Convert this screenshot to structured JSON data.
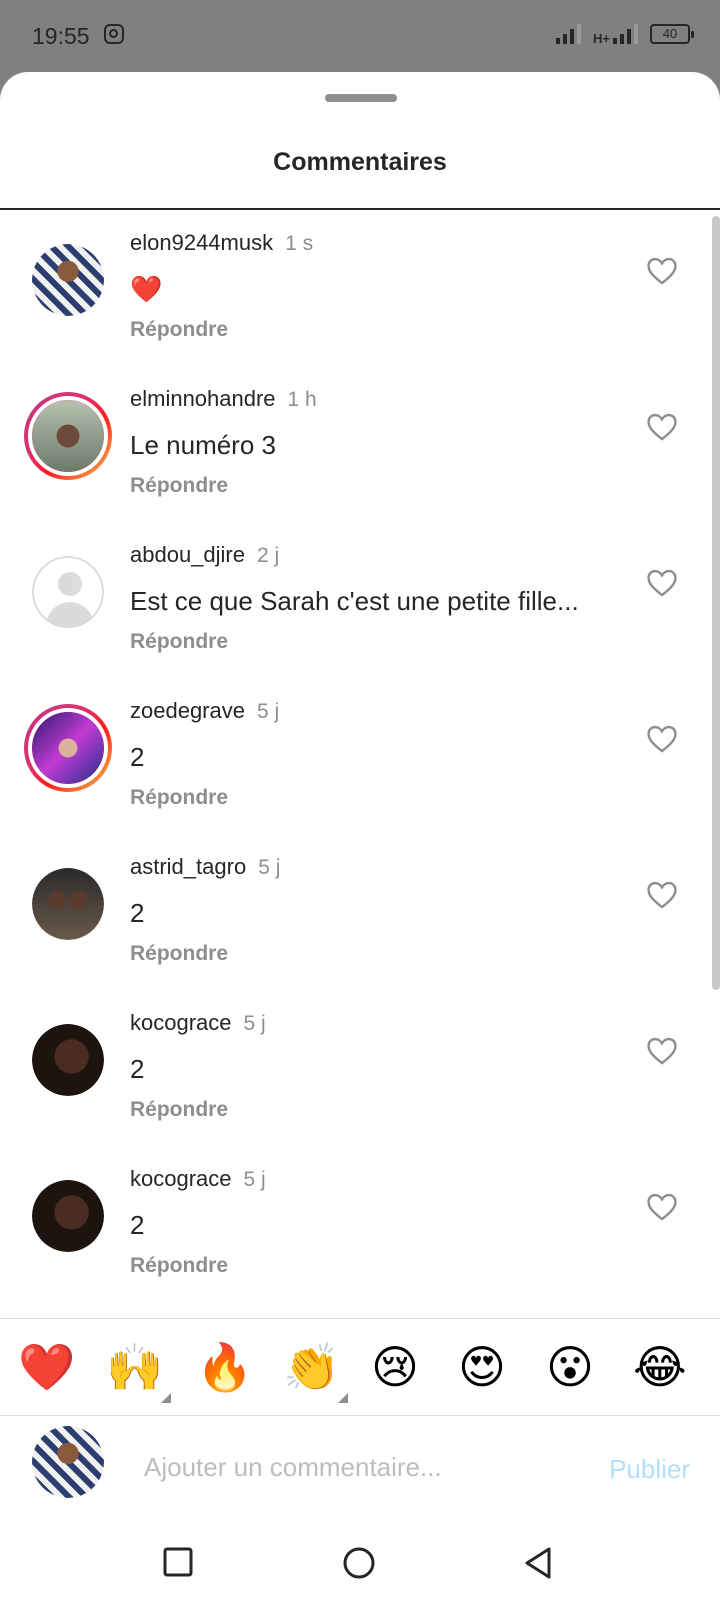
{
  "status_bar": {
    "time": "19:55",
    "network": "H+",
    "battery": "40"
  },
  "sheet": {
    "title": "Commentaires"
  },
  "comments": [
    {
      "username": "elon9244musk",
      "time": "1 s",
      "text": "❤️",
      "reply": "Répondre"
    },
    {
      "username": "elminnohandre",
      "time": "1 h",
      "text": "Le numéro 3",
      "reply": "Répondre"
    },
    {
      "username": "abdou_djire",
      "time": "2 j",
      "text": "Est ce que Sarah c'est une petite fille...",
      "reply": "Répondre"
    },
    {
      "username": "zoedegrave",
      "time": "5 j",
      "text": "2",
      "reply": "Répondre"
    },
    {
      "username": "astrid_tagro",
      "time": "5 j",
      "text": "2",
      "reply": "Répondre"
    },
    {
      "username": "kocograce",
      "time": "5 j",
      "text": "2",
      "reply": "Répondre"
    },
    {
      "username": "kocograce",
      "time": "5 j",
      "text": "2",
      "reply": "Répondre"
    }
  ],
  "quick_reactions": [
    "❤️",
    "🙌",
    "🔥",
    "👏",
    "😢",
    "😍",
    "😮",
    "😂"
  ],
  "composer": {
    "placeholder": "Ajouter un commentaire...",
    "publish_label": "Publier"
  },
  "colors": {
    "text": "#262626",
    "secondary": "#8e8e8e",
    "publish_disabled": "#b2dffc",
    "story_ring": "#e1306c"
  },
  "icons": {
    "like": "heart-outline-icon",
    "nav_recents": "square-icon",
    "nav_home": "circle-icon",
    "nav_back": "triangle-back-icon"
  }
}
